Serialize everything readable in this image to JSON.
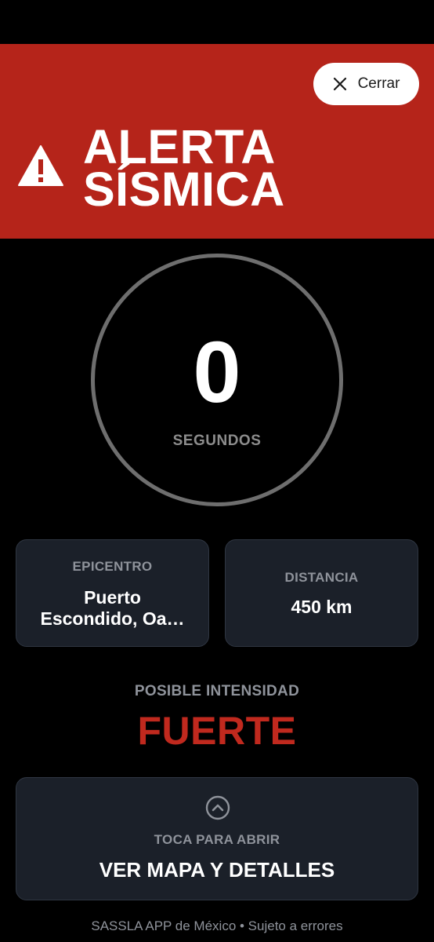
{
  "header": {
    "close_label": "Cerrar",
    "title_line1": "ALERTA",
    "title_line2": "SÍSMICA",
    "bg_color": "#b5241a"
  },
  "countdown": {
    "value": "0",
    "unit": "SEGUNDOS"
  },
  "epicenter": {
    "label": "EPICENTRO",
    "value_line1": "Puerto",
    "value_line2": "Escondido, Oa…"
  },
  "distance": {
    "label": "DISTANCIA",
    "value": "450 km"
  },
  "intensity": {
    "label": "POSIBLE INTENSIDAD",
    "value": "FUERTE",
    "color": "#c0291e"
  },
  "map_card": {
    "hint": "TOCA PARA ABRIR",
    "label": "VER MAPA Y DETALLES",
    "icon": "chevron-up-circle-icon"
  },
  "footer": {
    "text": "SASSLA APP de México • Sujeto a errores"
  }
}
